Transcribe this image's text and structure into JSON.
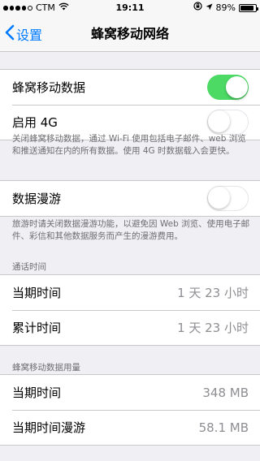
{
  "status_bar": {
    "carrier": "CTM",
    "time": "19:11",
    "battery_percent_text": "89%",
    "battery_level": 0.89
  },
  "nav": {
    "back_label": "设置",
    "title": "蜂窝移动网络"
  },
  "group1": {
    "cellular_data_label": "蜂窝移动数据",
    "cellular_data_on": true,
    "enable_4g_label": "启用 4G",
    "enable_4g_on": false
  },
  "group1_footer": "关闭蜂窝移动数据，通过 Wi-Fi 使用包括电子邮件、web 浏览和推送通知在内的所有数据。使用 4G 时数据载入会更快。",
  "group2": {
    "roaming_label": "数据漫游",
    "roaming_on": false
  },
  "group2_footer": "旅游时请关闭数据漫游功能，以避免因 Web 浏览、使用电子邮件、彩信和其他数据服务而产生的漫游费用。",
  "call_time": {
    "header": "通话时间",
    "current_period_label": "当期时间",
    "current_period_value": "1 天 23 小时",
    "lifetime_label": "累计时间",
    "lifetime_value": "1 天 23 小时"
  },
  "data_usage": {
    "header": "蜂窝移动数据用量",
    "current_period_label": "当期时间",
    "current_period_value": "348 MB",
    "current_roaming_label": "当期时间漫游",
    "current_roaming_value": "58.1 MB"
  },
  "colors": {
    "accent": "#007aff",
    "switch_on": "#4cd964",
    "background": "#efeff4",
    "secondary_text": "#8e8e93"
  }
}
